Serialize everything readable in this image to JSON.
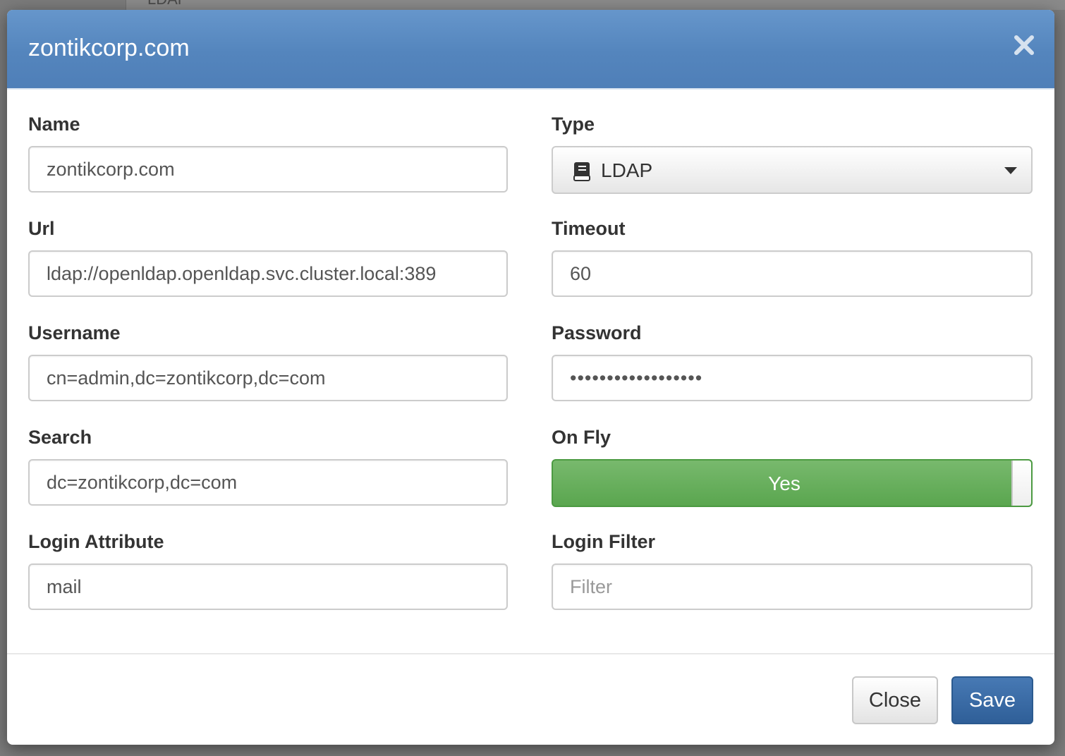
{
  "background": {
    "partial_text": "LDAP"
  },
  "modal": {
    "title": "zontikcorp.com",
    "close_icon": "close-icon"
  },
  "form": {
    "name": {
      "label": "Name",
      "value": "zontikcorp.com"
    },
    "type": {
      "label": "Type",
      "value": "LDAP",
      "icon": "book-icon"
    },
    "url": {
      "label": "Url",
      "value": "ldap://openldap.openldap.svc.cluster.local:389"
    },
    "timeout": {
      "label": "Timeout",
      "value": "60"
    },
    "username": {
      "label": "Username",
      "value": "cn=admin,dc=zontikcorp,dc=com"
    },
    "password": {
      "label": "Password",
      "value": "••••••••••••••••••"
    },
    "search": {
      "label": "Search",
      "value": "dc=zontikcorp,dc=com"
    },
    "on_fly": {
      "label": "On Fly",
      "value": "Yes"
    },
    "login_attribute": {
      "label": "Login Attribute",
      "value": "mail"
    },
    "login_filter": {
      "label": "Login Filter",
      "value": "",
      "placeholder": "Filter"
    }
  },
  "footer": {
    "close_label": "Close",
    "save_label": "Save"
  },
  "colors": {
    "header": "#5485bd",
    "toggle_on": "#5aa64f",
    "save_button": "#2f5f98"
  }
}
